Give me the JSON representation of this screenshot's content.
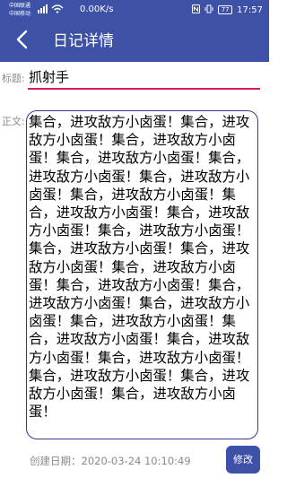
{
  "status_bar": {
    "carrier_1": "中国联通",
    "carrier_2": "中国移动",
    "net_speed": "0.00K/s",
    "battery": "77",
    "time": "17:57"
  },
  "app_bar": {
    "title": "日记详情",
    "back_icon": "chevron-left-icon"
  },
  "form": {
    "title_label": "标题:",
    "title_value": "抓射手",
    "body_label": "正文:",
    "body_value": "集合，进攻敌方小卤蛋！集合，进攻敌方小卤蛋！集合，进攻敌方小卤蛋！集合，进攻敌方小卤蛋！集合，进攻敌方小卤蛋！集合，进攻敌方小卤蛋！集合，进攻敌方小卤蛋！集合，进攻敌方小卤蛋！集合，进攻敌方小卤蛋！集合，进攻敌方小卤蛋！集合，进攻敌方小卤蛋！集合，进攻敌方小卤蛋！集合，进攻敌方小卤蛋！集合，进攻敌方小卤蛋！集合，进攻敌方小卤蛋！集合，进攻敌方小卤蛋！集合，进攻敌方小卤蛋！集合，进攻敌方小卤蛋！集合，进攻敌方小卤蛋！集合，进攻敌方小卤蛋！集合，进攻敌方小卤蛋！集合，进攻敌方小卤蛋！集合，进攻敌方小卤蛋！"
  },
  "footer": {
    "created_label": "创建日期：",
    "created_value": "2020-03-24 10:10:49",
    "edit_button": "修改"
  },
  "colors": {
    "primary": "#3d51a6",
    "accent_underline": "#d81b60",
    "label_gray": "#8a8a8a"
  }
}
